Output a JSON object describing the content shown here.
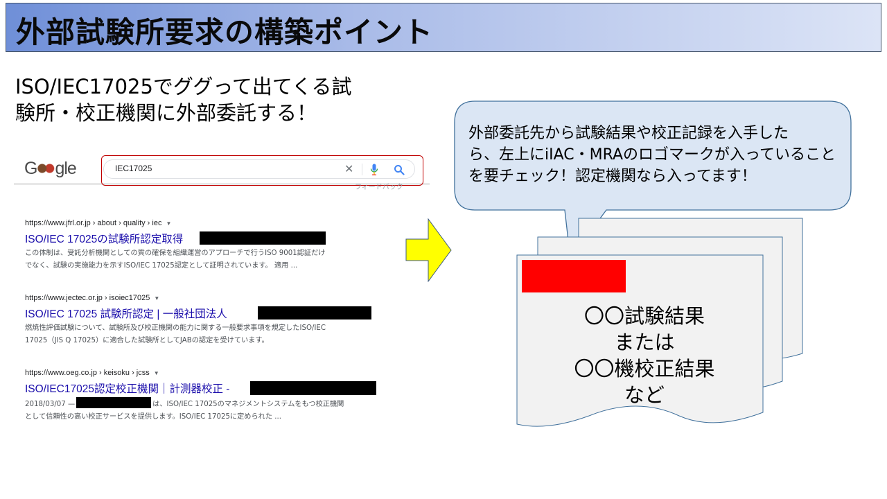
{
  "slide": {
    "title": "外部試験所要求の構築ポイント",
    "intro_line1": "ISO/IEC17025でググって出てくる試",
    "intro_line2": "験所・校正機関に外部委託する！"
  },
  "search": {
    "logo_prefix": "G",
    "logo_suffix": "gle",
    "query": "IEC17025",
    "feedback_label": "フィードバック",
    "results": [
      {
        "url": "https://www.jfrl.or.jp › about › quality › iec",
        "title": "ISO/IEC 17025の試験所認定取得",
        "snippet1": "この体制は、受託分析機関としての質の確保を組織運営のアプローチで行うISO 9001認証だけ",
        "snippet2": "でなく、試験の実施能力を示すISO/IEC 17025認定として証明されています。 適用 ..."
      },
      {
        "url": "https://www.jectec.or.jp › isoiec17025",
        "title": "ISO/IEC 17025 試験所認定 | 一般社団法人",
        "snippet1": "燃焼性評価試験について、試験所及び校正機関の能力に関する一般要求事項を規定したISO/IEC",
        "snippet2": "17025（JIS Q 17025）に適合した試験所としてJABの認定を受けています。"
      },
      {
        "url": "https://www.oeg.co.jp › keisoku › jcss",
        "title": "ISO/IEC17025認定校正機関｜計測器校正 -",
        "snippet1_prefix": "2018/03/07 —",
        "snippet1_suffix": "は、ISO/IEC 17025のマネジメントシステムをもつ校正機関",
        "snippet2": "として信頼性の高い校正サービスを提供します。ISO/IEC 17025に定められた ..."
      }
    ]
  },
  "callout": {
    "line1": "外部委託先から試験結果や校正記録を入手した",
    "line2": "ら、左上にiIAC・MRAのロゴマークが入っていること",
    "line3": "を要チェック！認定機関なら入ってます！"
  },
  "document": {
    "line1": "〇〇試験結果",
    "line2": "または",
    "line3": "〇〇機校正結果",
    "line4": "など"
  },
  "colors": {
    "title_gradient_start": "#6f8fd8",
    "title_gradient_end": "#dce4f6",
    "callout_fill": "#dbe6f4",
    "callout_stroke": "#41719c",
    "arrow_fill": "#ffff00",
    "logo_red": "#ff0000",
    "highlight_red": "#c00000",
    "link_blue": "#1a0dab"
  },
  "icons": {
    "clear": "close-icon",
    "mic": "microphone-icon",
    "search": "search-icon",
    "arrow": "arrow-right-icon"
  }
}
